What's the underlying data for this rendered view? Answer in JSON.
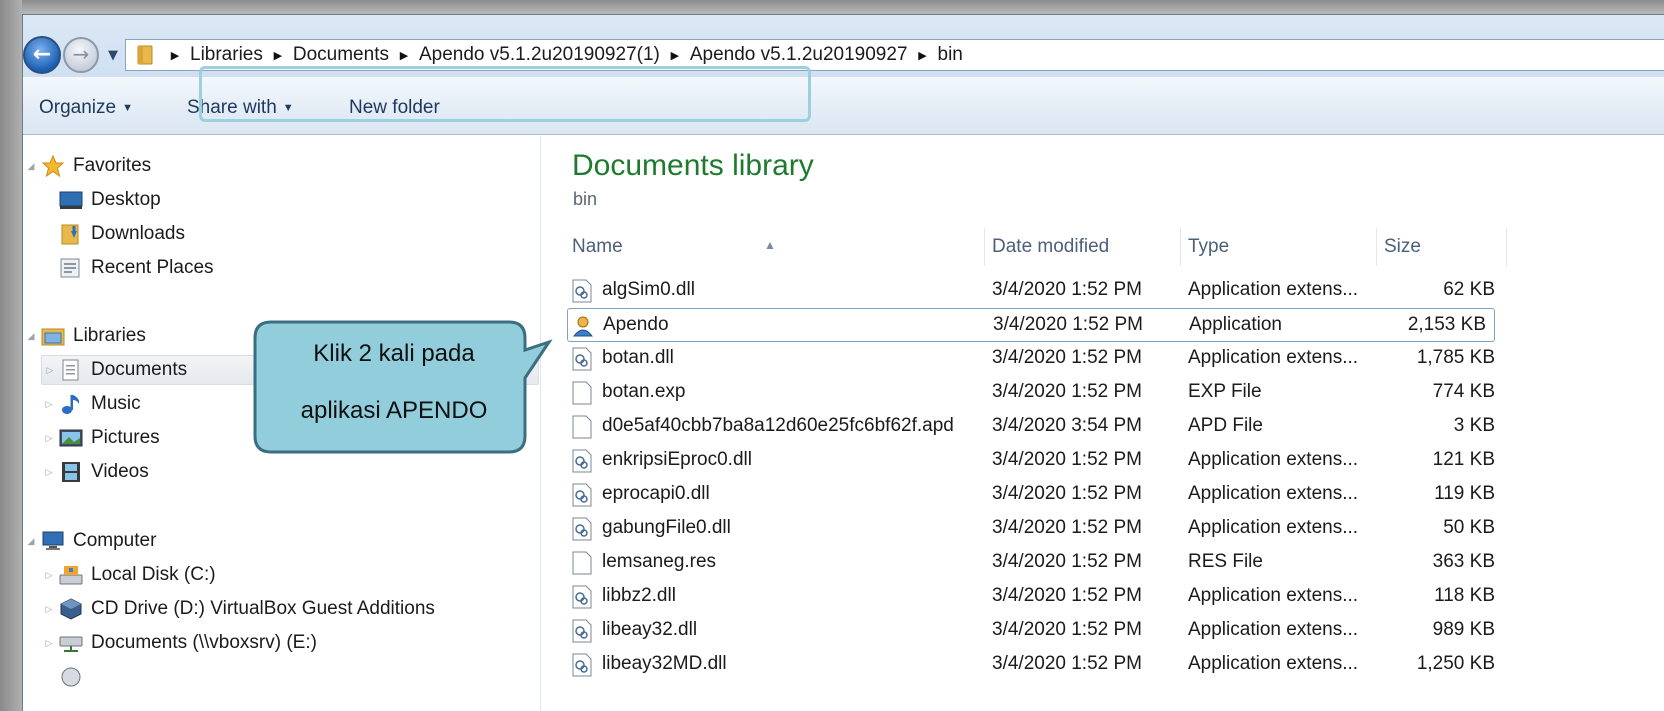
{
  "address": {
    "breadcrumb": [
      "Libraries",
      "Documents",
      "Apendo v5.1.2u20190927(1)",
      "Apendo v5.1.2u20190927",
      "bin"
    ],
    "back_icon": "back-arrow-icon",
    "forward_icon": "forward-arrow-icon"
  },
  "toolbar": {
    "organize_label": "Organize",
    "share_label": "Share with",
    "new_folder_label": "New folder"
  },
  "nav": {
    "favorites_label": "Favorites",
    "desktop_label": "Desktop",
    "downloads_label": "Downloads",
    "recent_label": "Recent Places",
    "libraries_label": "Libraries",
    "documents_label": "Documents",
    "music_label": "Music",
    "pictures_label": "Pictures",
    "videos_label": "Videos",
    "computer_label": "Computer",
    "local_disk_label": "Local Disk (C:)",
    "cd_drive_label": "CD Drive (D:) VirtualBox Guest Additions",
    "network_docs_label": "Documents (\\\\vboxsrv) (E:)"
  },
  "content": {
    "title": "Documents library",
    "subtitle": "bin",
    "columns": {
      "name": "Name",
      "date": "Date modified",
      "type": "Type",
      "size": "Size"
    },
    "files": [
      {
        "name": "algSim0.dll",
        "date": "3/4/2020 1:52 PM",
        "type": "Application extens...",
        "size": "62 KB",
        "icon": "dll-file-icon"
      },
      {
        "name": "Apendo",
        "date": "3/4/2020 1:52 PM",
        "type": "Application",
        "size": "2,153 KB",
        "icon": "application-icon"
      },
      {
        "name": "botan.dll",
        "date": "3/4/2020 1:52 PM",
        "type": "Application extens...",
        "size": "1,785 KB",
        "icon": "dll-file-icon"
      },
      {
        "name": "botan.exp",
        "date": "3/4/2020 1:52 PM",
        "type": "EXP File",
        "size": "774 KB",
        "icon": "blank-file-icon"
      },
      {
        "name": "d0e5af40cbb7ba8a12d60e25fc6bf62f.apd",
        "date": "3/4/2020 3:54 PM",
        "type": "APD File",
        "size": "3 KB",
        "icon": "blank-file-icon"
      },
      {
        "name": "enkripsiEproc0.dll",
        "date": "3/4/2020 1:52 PM",
        "type": "Application extens...",
        "size": "121 KB",
        "icon": "dll-file-icon"
      },
      {
        "name": "eprocapi0.dll",
        "date": "3/4/2020 1:52 PM",
        "type": "Application extens...",
        "size": "119 KB",
        "icon": "dll-file-icon"
      },
      {
        "name": "gabungFile0.dll",
        "date": "3/4/2020 1:52 PM",
        "type": "Application extens...",
        "size": "50 KB",
        "icon": "dll-file-icon"
      },
      {
        "name": "lemsaneg.res",
        "date": "3/4/2020 1:52 PM",
        "type": "RES File",
        "size": "363 KB",
        "icon": "blank-file-icon"
      },
      {
        "name": "libbz2.dll",
        "date": "3/4/2020 1:52 PM",
        "type": "Application extens...",
        "size": "118 KB",
        "icon": "dll-file-icon"
      },
      {
        "name": "libeay32.dll",
        "date": "3/4/2020 1:52 PM",
        "type": "Application extens...",
        "size": "989 KB",
        "icon": "dll-file-icon"
      },
      {
        "name": "libeay32MD.dll",
        "date": "3/4/2020 1:52 PM",
        "type": "Application extens...",
        "size": "1,250 KB",
        "icon": "dll-file-icon"
      }
    ]
  },
  "callout": {
    "line1": "Klik 2 kali pada",
    "line2": "aplikasi APENDO"
  },
  "colors": {
    "library_title": "#1e7a2e",
    "callout_fill": "#92cddc",
    "callout_border": "#3b6e80",
    "highlight_border": "#9ccfe0",
    "selection_border": "#7da2ce"
  }
}
